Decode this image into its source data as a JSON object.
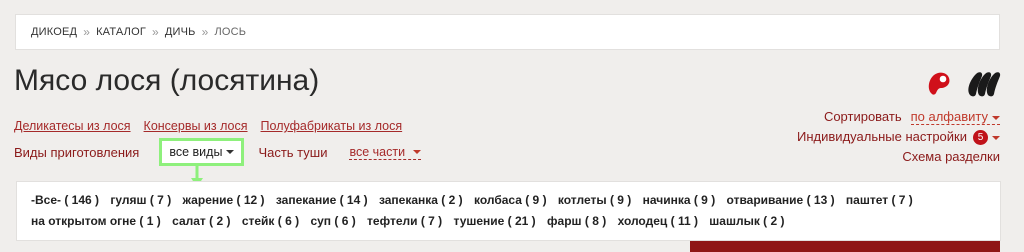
{
  "breadcrumb": [
    "ДИКОЕД",
    "КАТАЛОГ",
    "ДИЧЬ",
    "ЛОСЬ"
  ],
  "breadcrumb_separator": "»",
  "title": "Мясо лося (лосятина)",
  "sub_links": [
    "Деликатесы из лося",
    "Консервы из лося",
    "Полуфабрикаты из лося"
  ],
  "filters": {
    "cooking_label": "Виды приготовления",
    "cooking_value": "все виды",
    "carcass_label": "Часть туши",
    "carcass_value": "все части"
  },
  "right_panel": {
    "sort_label": "Сортировать",
    "sort_value": "по алфавиту",
    "settings_label": "Индивидуальные настройки",
    "settings_count": "5",
    "scheme_label": "Схема разделки"
  },
  "icons": [
    "single-cut-icon",
    "multi-cut-icon",
    "down-arrow-icon"
  ],
  "tags": [
    "-Все- ( 146 )",
    "гуляш ( 7 )",
    "жарение ( 12 )",
    "запекание ( 14 )",
    "запеканка ( 2 )",
    "колбаса ( 9 )",
    "котлеты ( 9 )",
    "начинка ( 9 )",
    "отваривание ( 13 )",
    "паштет ( 7 )",
    "на открытом огне ( 1 )",
    "салат ( 2 )",
    "стейк ( 6 )",
    "суп ( 6 )",
    "тефтели ( 7 )",
    "тушение ( 21 )",
    "фарш ( 8 )",
    "холодец ( 11 )",
    "шашлык ( 2 )"
  ],
  "colors": {
    "accent": "#a52a2a",
    "highlight": "#8ef07c",
    "badge": "#c0121a"
  }
}
